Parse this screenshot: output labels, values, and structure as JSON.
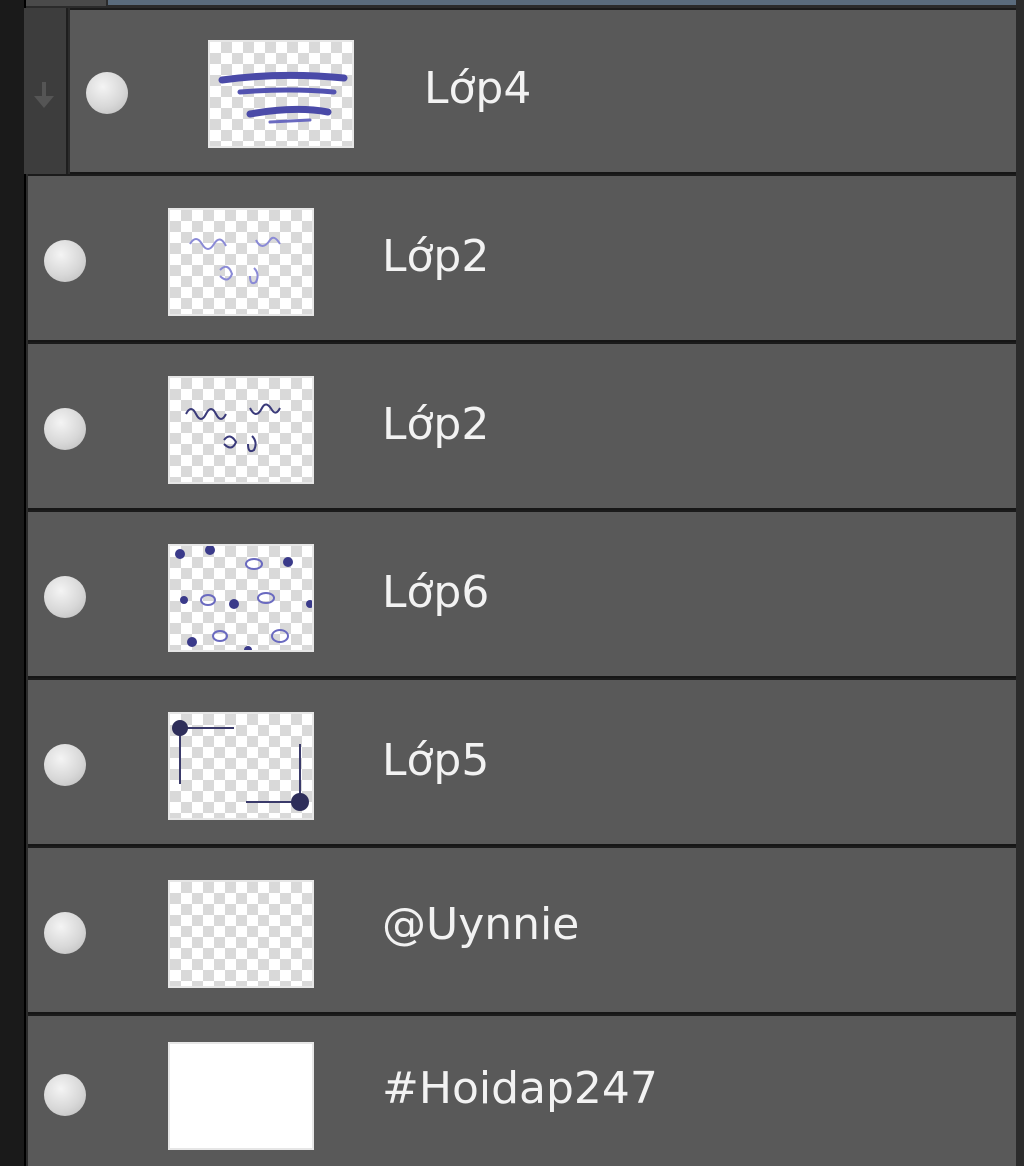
{
  "layers_panel": {
    "group": {
      "child_layer": {
        "name": "Lớp4",
        "thumbnail": "brush-strokes-thumbnail"
      }
    },
    "layers": [
      {
        "name": "Lớp2",
        "thumbnail": "light-handwriting-thumbnail"
      },
      {
        "name": "Lớp2",
        "thumbnail": "handwriting-thumbnail"
      },
      {
        "name": "Lớp6",
        "thumbnail": "dots-doodle-thumbnail"
      },
      {
        "name": "Lớp5",
        "thumbnail": "corner-frame-thumbnail"
      },
      {
        "name": "@Uynnie",
        "thumbnail": "transparent-thumbnail"
      },
      {
        "name": "#Hoidap247",
        "thumbnail": "white-thumbnail"
      }
    ]
  },
  "colors": {
    "panel_bg": "#2b2b2b",
    "row_bg": "#595959",
    "row_border": "#1b1b1b",
    "text": "#f2f2f2",
    "ink": "#4a4aa8"
  }
}
